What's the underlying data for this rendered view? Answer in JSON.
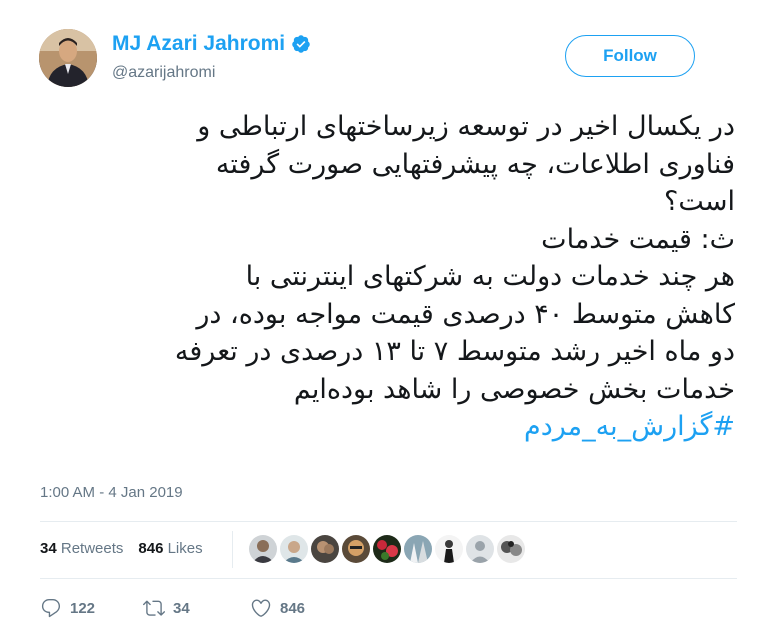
{
  "user": {
    "display_name": "MJ Azari Jahromi",
    "handle": "@azarijahromi",
    "verified": true
  },
  "follow_label": "Follow",
  "tweet": {
    "lines": [
      "در یکسال اخیر در توسعه زیرساختهای ارتباطی و",
      "فناوری اطلاعات، چه پیشرفتهایی صورت گرفته",
      "است؟",
      "ث: قیمت خدمات",
      "هر چند خدمات دولت به شرکتهای اینترنتی با",
      "کاهش متوسط ۴۰ درصدی قیمت مواجه بوده، در",
      "دو ماه اخیر رشد متوسط ۷ تا ۱۳ درصدی در تعرفه",
      "خدمات بخش خصوصی را شاهد بوده‌ایم"
    ],
    "hashtag": "#گزارش_به_مردم",
    "timestamp": "1:00 AM - 4 Jan 2019"
  },
  "stats": {
    "retweets_count": "34",
    "retweets_label": "Retweets",
    "likes_count": "846",
    "likes_label": "Likes"
  },
  "liker_avatars": [
    "avatar-1",
    "avatar-2",
    "avatar-3",
    "avatar-4",
    "avatar-5",
    "avatar-6",
    "avatar-7",
    "avatar-8",
    "avatar-9"
  ],
  "actions": {
    "reply_count": "122",
    "retweet_count": "34",
    "like_count": "846"
  },
  "colors": {
    "accent": "#1da1f2",
    "secondary_text": "#657786",
    "divider": "#e6ecf0"
  },
  "icons": [
    "verified-badge-icon",
    "reply-icon",
    "retweet-icon",
    "heart-icon"
  ]
}
